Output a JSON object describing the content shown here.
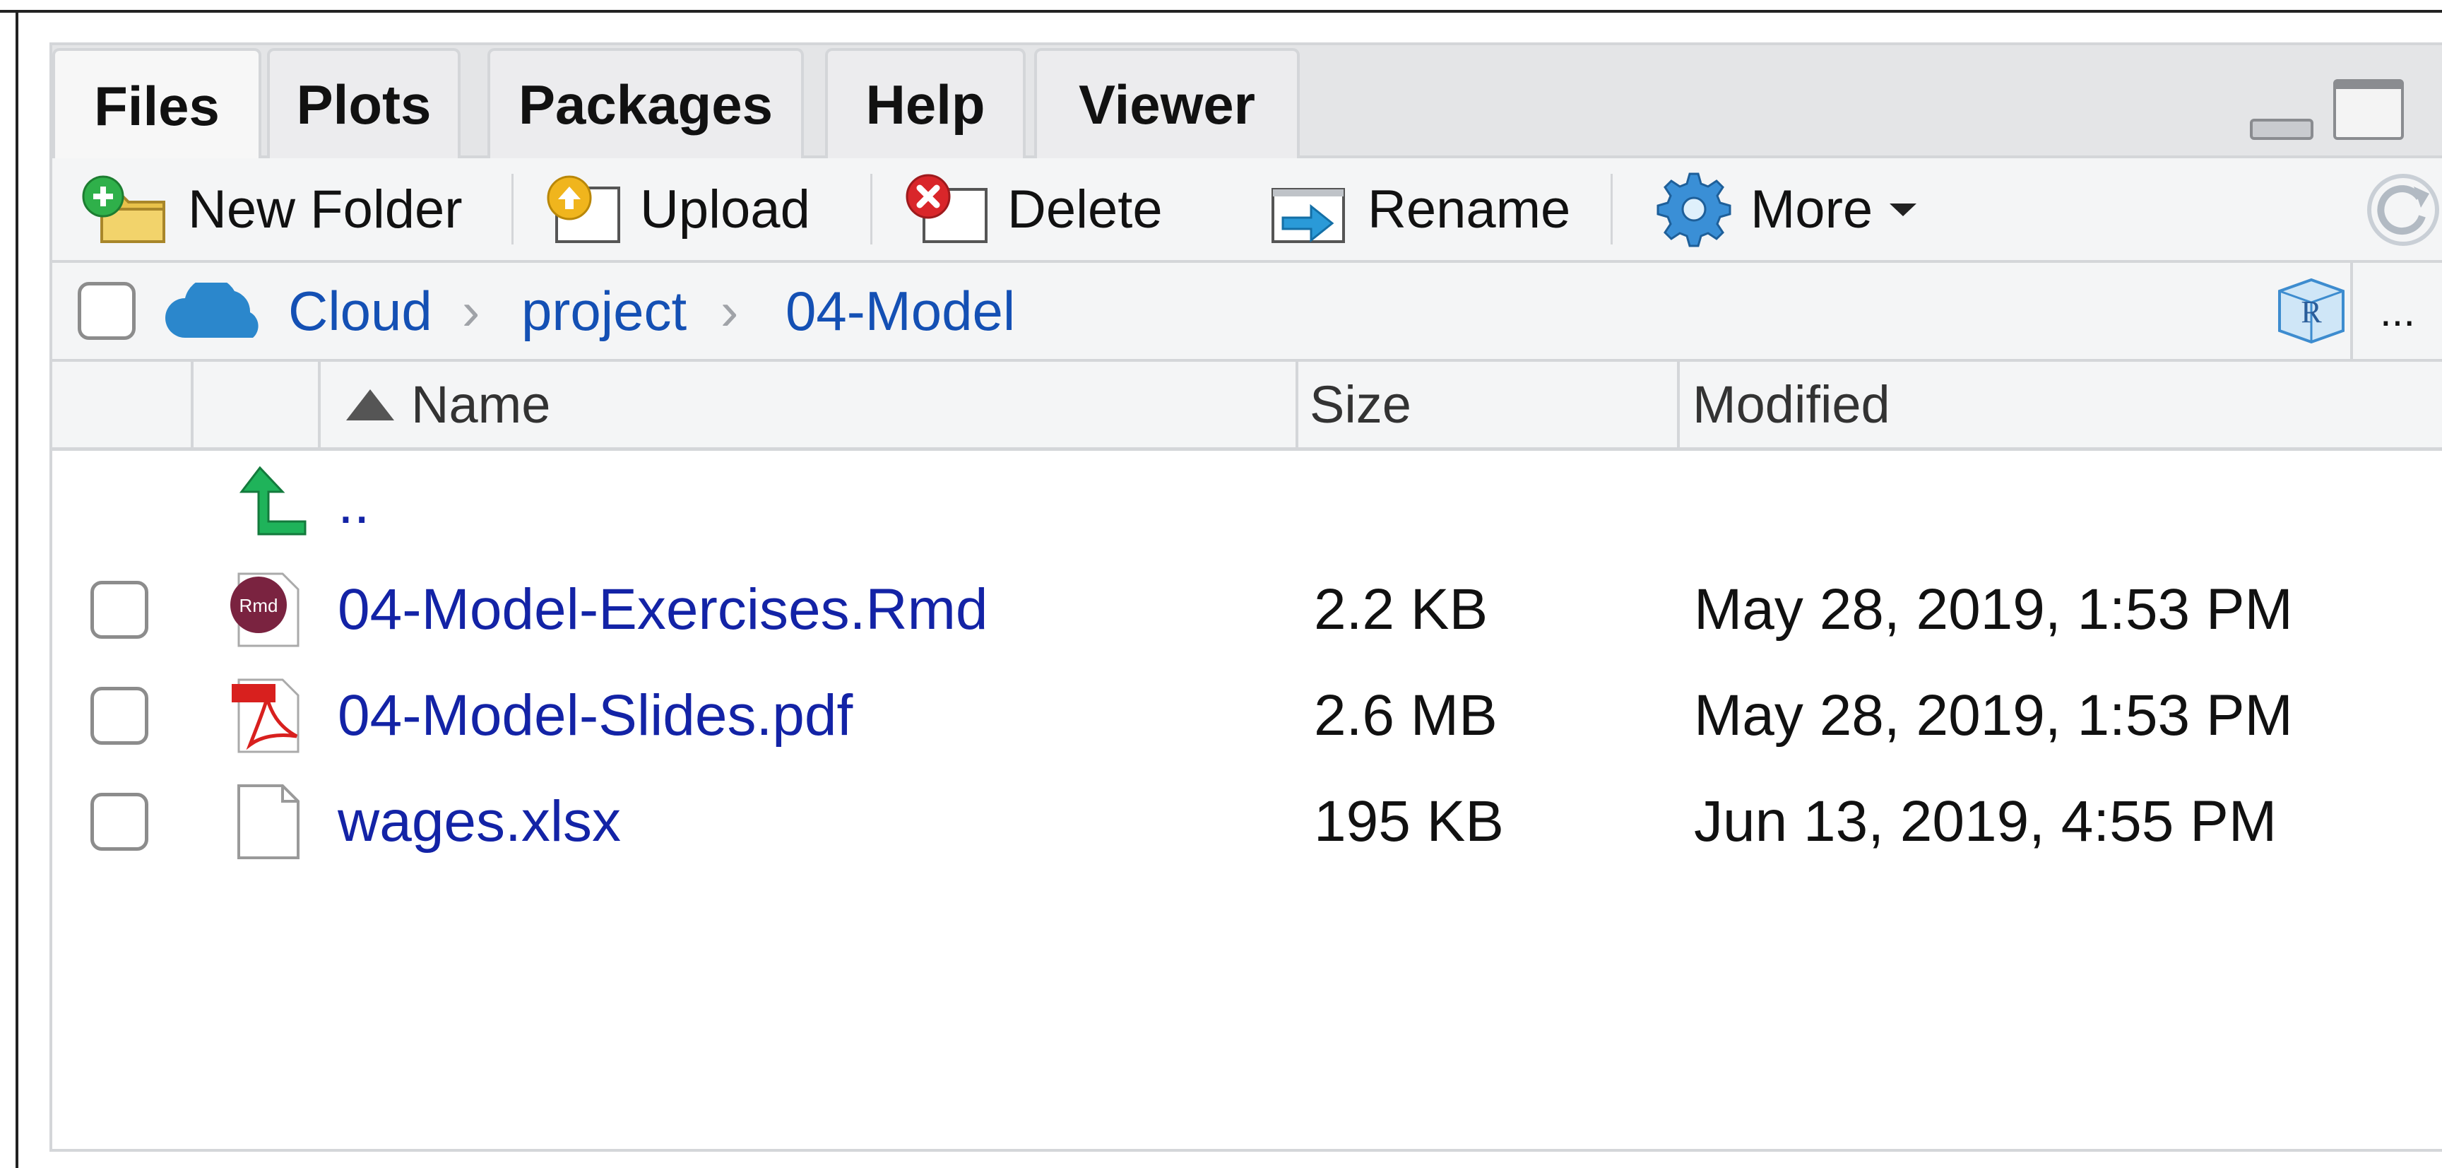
{
  "tabs": [
    {
      "label": "Files",
      "active": true
    },
    {
      "label": "Plots",
      "active": false
    },
    {
      "label": "Packages",
      "active": false
    },
    {
      "label": "Help",
      "active": false
    },
    {
      "label": "Viewer",
      "active": false
    }
  ],
  "toolbar": {
    "new_folder": "New Folder",
    "upload": "Upload",
    "delete": "Delete",
    "rename": "Rename",
    "more": "More"
  },
  "breadcrumb": {
    "root": "Cloud",
    "items": [
      "project",
      "04-Model"
    ]
  },
  "overflow_menu": "...",
  "columns": {
    "name": "Name",
    "size": "Size",
    "modified": "Modified"
  },
  "parent_dir": "..",
  "files": [
    {
      "name": "04-Model-Exercises.Rmd",
      "size": "2.2 KB",
      "modified": "May 28, 2019, 1:53 PM",
      "icon": "rmd-file-icon"
    },
    {
      "name": "04-Model-Slides.pdf",
      "size": "2.6 MB",
      "modified": "May 28, 2019, 1:53 PM",
      "icon": "pdf-file-icon"
    },
    {
      "name": "wages.xlsx",
      "size": "195 KB",
      "modified": "Jun 13, 2019, 4:55 PM",
      "icon": "generic-file-icon"
    }
  ],
  "colors": {
    "link": "#1450b4",
    "file_link": "#1323a6",
    "chrome_bg": "#f4f5f6",
    "border": "#d4d6d9"
  }
}
